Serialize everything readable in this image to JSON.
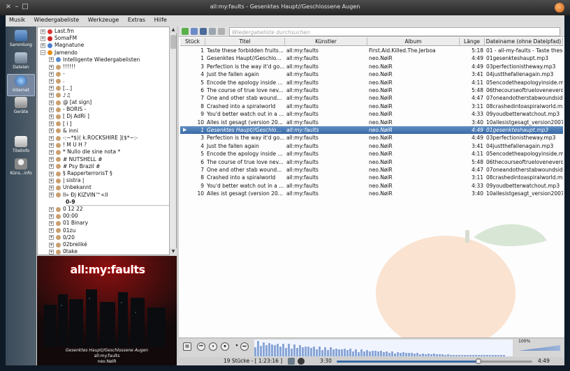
{
  "window": {
    "title": "all:my:faults - Gesenktes Haupt//Geschlossene Augen"
  },
  "menu": [
    "Musik",
    "Wiedergabeliste",
    "Werkzeuge",
    "Extras",
    "Hilfe"
  ],
  "sidebar": [
    {
      "label": "Sammlung",
      "icon": "collection-icon"
    },
    {
      "label": "Dateien",
      "icon": "files-icon"
    },
    {
      "label": "Internet",
      "icon": "internet-icon",
      "active": true
    },
    {
      "label": "Geräte",
      "icon": "devices-icon"
    },
    {
      "label": "Titelinfo",
      "icon": "track-info-icon"
    },
    {
      "label": "Küns...info",
      "icon": "artist-info-icon"
    }
  ],
  "tree": [
    {
      "label": "Last.fm",
      "depth": 0,
      "exp": "+",
      "icon": "#d33"
    },
    {
      "label": "SomaFM",
      "depth": 0,
      "exp": "+",
      "icon": "#c22"
    },
    {
      "label": "Magnatune",
      "depth": 0,
      "exp": "+",
      "icon": "#4a7fd0"
    },
    {
      "label": "Jamendo",
      "depth": 0,
      "exp": "−",
      "icon": "#e88a1a"
    },
    {
      "label": "Intelligente Wiedergabelisten",
      "depth": 1,
      "exp": "+",
      "icon": "#5a8ad0"
    },
    {
      "label": "!!!!!!",
      "depth": 1,
      "exp": "+",
      "icon": "#c9a070"
    },
    {
      "label": "-",
      "depth": 1,
      "exp": "+",
      "icon": "#c9a070"
    },
    {
      "label": ".",
      "depth": 1,
      "exp": "+",
      "icon": "#c9a070"
    },
    {
      "label": "[...]",
      "depth": 1,
      "exp": "+",
      "icon": "#c9a070"
    },
    {
      "label": "♪♫",
      "depth": 1,
      "exp": "+",
      "icon": "#c9a070"
    },
    {
      "label": "@ [at sign]",
      "depth": 1,
      "exp": "+",
      "icon": "#c9a070"
    },
    {
      "label": "- BORIS -",
      "depth": 1,
      "exp": "+",
      "icon": "#c9a070"
    },
    {
      "label": "[ Dj AdRi ]",
      "depth": 1,
      "exp": "+",
      "icon": "#c9a070"
    },
    {
      "label": "[ i ]",
      "depth": 1,
      "exp": "+",
      "icon": "#c9a070"
    },
    {
      "label": "& inni",
      "depth": 1,
      "exp": "+",
      "icon": "#c9a070"
    },
    {
      "label": "-:~*$)( k.ROCKSHIRE ]($*~:-",
      "depth": 1,
      "exp": "+",
      "icon": "#c9a070"
    },
    {
      "label": "! M U H ?",
      "depth": 1,
      "exp": "+",
      "icon": "#c9a070"
    },
    {
      "label": "* Nullo die sine nota *",
      "depth": 1,
      "exp": "+",
      "icon": "#c9a070"
    },
    {
      "label": "# NUTSHELL #",
      "depth": 1,
      "exp": "+",
      "icon": "#c9a070"
    },
    {
      "label": "# Psy Brazil #",
      "depth": 1,
      "exp": "+",
      "icon": "#c9a070"
    },
    {
      "label": "§ RapperterrorisT §",
      "depth": 1,
      "exp": "+",
      "icon": "#c9a070"
    },
    {
      "label": "| sistra |",
      "depth": 1,
      "exp": "+",
      "icon": "#c9a070"
    },
    {
      "label": "Unbekannt",
      "depth": 1,
      "exp": "+",
      "icon": "#c9a070"
    },
    {
      "label": "ll» Ðj KIZVIN™<ll",
      "depth": 1,
      "exp": "+",
      "icon": "#c9a070"
    },
    {
      "label": "0-9",
      "depth": 1,
      "header": true
    },
    {
      "label": "0 12 22",
      "depth": 1,
      "exp": "+",
      "icon": "#c9a070"
    },
    {
      "label": "00:00",
      "depth": 1,
      "exp": "+",
      "icon": "#c9a070"
    },
    {
      "label": "01 Binary",
      "depth": 1,
      "exp": "+",
      "icon": "#c9a070"
    },
    {
      "label": "01zu",
      "depth": 1,
      "exp": "+",
      "icon": "#c9a070"
    },
    {
      "label": "0/20",
      "depth": 1,
      "exp": "+",
      "icon": "#c9a070"
    },
    {
      "label": "02breliké",
      "depth": 1,
      "exp": "+",
      "icon": "#c9a070"
    },
    {
      "label": "0take",
      "depth": 1,
      "exp": "+",
      "icon": "#c9a070"
    }
  ],
  "albumart": {
    "band": "all:my:faults",
    "caption1": "Gesenktes Haupt//Geschlossene Augen",
    "caption2": "all:my:faults",
    "caption3": "neo.NøiR"
  },
  "search": {
    "placeholder": "Wiedergabeliste durchsuchen"
  },
  "columns": [
    "Stück",
    "Titel",
    "Künstler",
    "Album",
    "Länge",
    "Dateiname (ohne Dateipfad)"
  ],
  "playlist": [
    {
      "n": "1",
      "title": "Taste these forbidden fruits...",
      "artist": "all:my:faults",
      "album": "First.Aid.Killed.The.Jerboa",
      "len": "5:18",
      "file": "01 - all-my-faults - Taste these..."
    },
    {
      "n": "1",
      "title": "Gesenktes Haupt//Geschlo...",
      "artist": "all:my:faults",
      "album": "neo.NøiR",
      "len": "4:49",
      "file": "01gesenkteshaupt.mp3"
    },
    {
      "n": "3",
      "title": "Perfection is the way it'd go...",
      "artist": "all:my:faults",
      "album": "neo.NøiR",
      "len": "4:49",
      "file": "03perfectionistheway.mp3"
    },
    {
      "n": "4",
      "title": "Just the fallen again",
      "artist": "all:my:faults",
      "album": "neo.NøiR",
      "len": "3:41",
      "file": "04justthefallenagain.mp3"
    },
    {
      "n": "5",
      "title": "Encode the apology inside ...",
      "artist": "all:my:faults",
      "album": "neo.NøiR",
      "len": "4:11",
      "file": "05encodetheapologyinside.mp3"
    },
    {
      "n": "6",
      "title": "The course of true love nev...",
      "artist": "all:my:faults",
      "album": "neo.NøiR",
      "len": "5:48",
      "file": "06thecourseoftrueloveneverdi..."
    },
    {
      "n": "7",
      "title": "One and other stab wound...",
      "artist": "all:my:faults",
      "album": "neo.NøiR",
      "len": "4:47",
      "file": "07oneandotherstabwoundside..."
    },
    {
      "n": "8",
      "title": "Crashed into a spiralworld",
      "artist": "all:my:faults",
      "album": "neo.NøiR",
      "len": "3:11",
      "file": "08crashedintoaspiralworld.mp3"
    },
    {
      "n": "9",
      "title": "You'd better watch out in a ...",
      "artist": "all:my:faults",
      "album": "neo.NøiR",
      "len": "4:33",
      "file": "09youdbetterwatchout.mp3"
    },
    {
      "n": "10",
      "title": "Alles ist gesagt (version 20...",
      "artist": "all:my:faults",
      "album": "neo.NøiR",
      "len": "3:40",
      "file": "10allesistgesagt_version2007..."
    },
    {
      "n": "1",
      "title": "Gesenktes Haupt//Geschlo...",
      "artist": "all:my:faults",
      "album": "neo.NøiR",
      "len": "4:49",
      "file": "01gesenkteshaupt.mp3",
      "playing": true
    },
    {
      "n": "3",
      "title": "Perfection is the way it'd go...",
      "artist": "all:my:faults",
      "album": "neo.NøiR",
      "len": "4:49",
      "file": "03perfectionistheway.mp3"
    },
    {
      "n": "4",
      "title": "Just the fallen again",
      "artist": "all:my:faults",
      "album": "neo.NøiR",
      "len": "3:41",
      "file": "04justthefallenagain.mp3"
    },
    {
      "n": "5",
      "title": "Encode the apology inside ...",
      "artist": "all:my:faults",
      "album": "neo.NøiR",
      "len": "4:11",
      "file": "05encodetheapologyinside.mp3"
    },
    {
      "n": "6",
      "title": "The course of true love nev...",
      "artist": "all:my:faults",
      "album": "neo.NøiR",
      "len": "5:48",
      "file": "06thecourseoftrueloveneverdi..."
    },
    {
      "n": "7",
      "title": "One and other stab wound...",
      "artist": "all:my:faults",
      "album": "neo.NøiR",
      "len": "4:47",
      "file": "07oneandotherstabwoundside..."
    },
    {
      "n": "8",
      "title": "Crashed into a spiralworld",
      "artist": "all:my:faults",
      "album": "neo.NøiR",
      "len": "3:11",
      "file": "08crashedintoaspiralworld.mp3"
    },
    {
      "n": "9",
      "title": "You'd better watch out in a ...",
      "artist": "all:my:faults",
      "album": "neo.NøiR",
      "len": "4:33",
      "file": "09youdbetterwatchout.mp3"
    },
    {
      "n": "10",
      "title": "Alles ist gesagt (version 20...",
      "artist": "all:my:faults",
      "album": "neo.NøiR",
      "len": "3:40",
      "file": "10allesistgesagt_version2007..."
    }
  ],
  "status": {
    "count": "19 Stücke - [ 1:23:16 ]",
    "elapsed": "3:30",
    "total": "4:49",
    "progress_fraction": 0.726,
    "volume": "100%"
  },
  "colors": {
    "selection": "#3a6aa6",
    "accent": "#e88a1a"
  }
}
